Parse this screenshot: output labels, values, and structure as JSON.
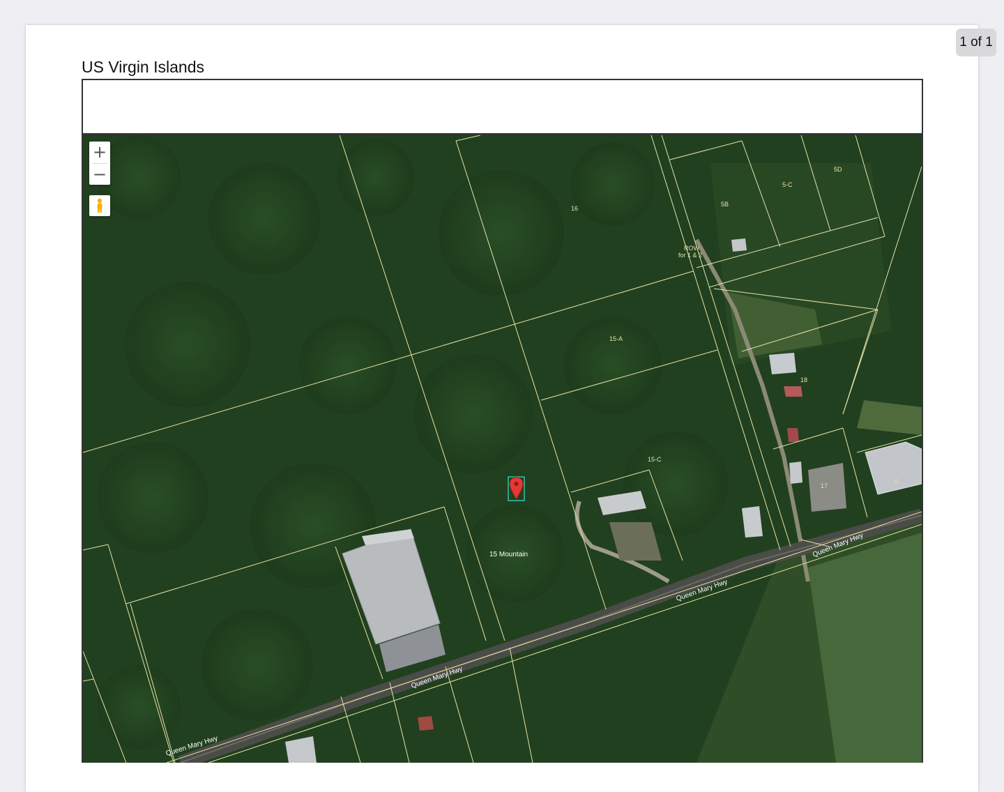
{
  "document": {
    "title": "US Virgin Islands",
    "page_indicator": "1 of 1"
  },
  "map": {
    "controls": {
      "zoom_in": "+",
      "zoom_out": "−",
      "street_view_icon": "pegman-icon"
    },
    "parcel_labels": [
      "16",
      "5D",
      "5-C",
      "5B",
      "ROW",
      "for 1 & 2",
      "15-A",
      "18",
      "15-C",
      "17",
      "6"
    ],
    "road_labels": [
      "Queen Mary Hwy",
      "Queen Mary Hwy",
      "Queen Mary Hwy",
      "Queen Mary Hwy"
    ],
    "address_label": "15 Mountain",
    "marker_icon": "map-pin-icon",
    "colors": {
      "parcel_line": "#e8e3a6",
      "marker": "#e53935",
      "marker_highlight": "#2ec4a8"
    }
  }
}
